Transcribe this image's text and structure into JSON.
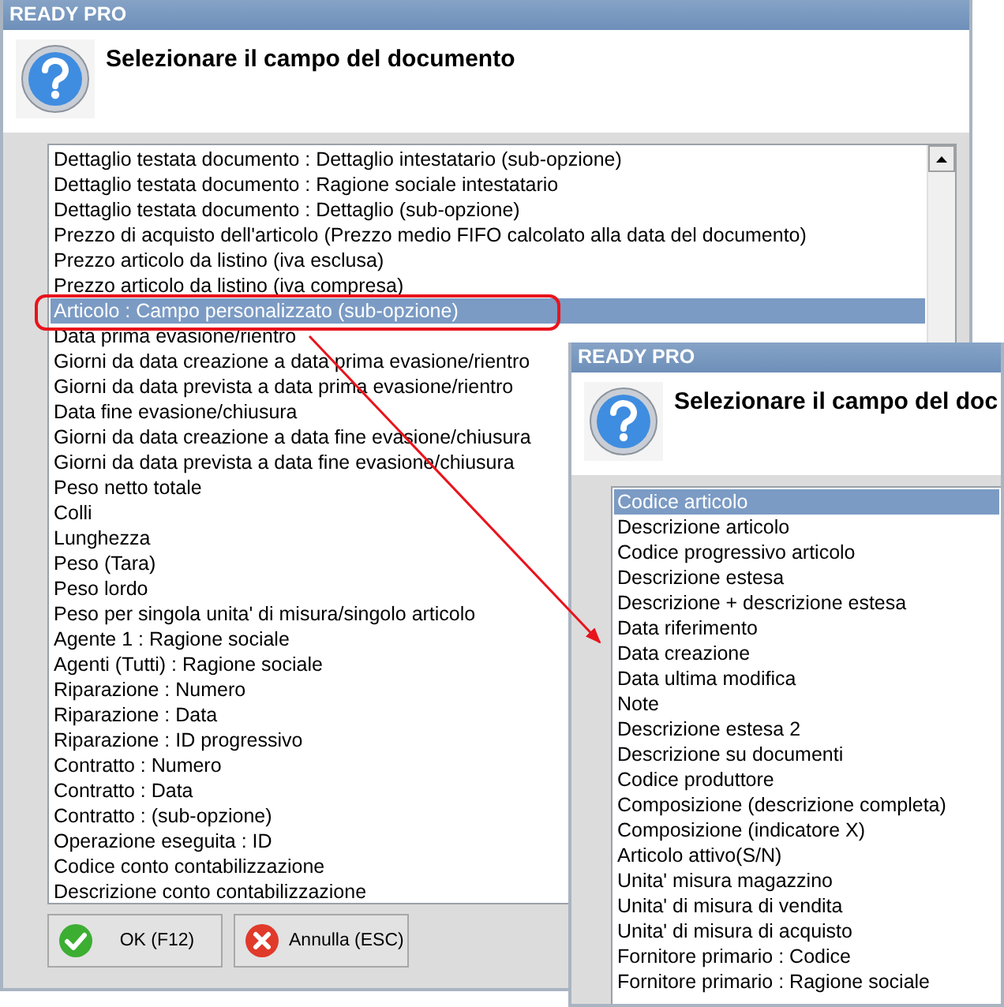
{
  "windows": [
    {
      "title": "READY PRO",
      "heading": "Selezionare il campo del documento",
      "scrollbar": true,
      "items": [
        {
          "label": "Dettaglio testata documento : Dettaglio intestatario (sub-opzione)",
          "selected": false
        },
        {
          "label": "Dettaglio testata documento : Ragione sociale intestatario",
          "selected": false
        },
        {
          "label": "Dettaglio testata documento : Dettaglio (sub-opzione)",
          "selected": false
        },
        {
          "label": "Prezzo di acquisto dell'articolo (Prezzo medio FIFO calcolato alla data del documento)",
          "selected": false
        },
        {
          "label": "Prezzo articolo da listino (iva esclusa)",
          "selected": false
        },
        {
          "label": "Prezzo articolo da listino (iva compresa)",
          "selected": false
        },
        {
          "label": "Articolo : Campo personalizzato (sub-opzione)",
          "selected": true
        },
        {
          "label": "Data prima evasione/rientro",
          "selected": false
        },
        {
          "label": "Giorni da data creazione a data prima evasione/rientro",
          "selected": false
        },
        {
          "label": "Giorni da data prevista a data prima evasione/rientro",
          "selected": false
        },
        {
          "label": "Data fine evasione/chiusura",
          "selected": false
        },
        {
          "label": "Giorni da data creazione a data fine evasione/chiusura",
          "selected": false
        },
        {
          "label": "Giorni da data prevista a data fine evasione/chiusura",
          "selected": false
        },
        {
          "label": "Peso netto totale",
          "selected": false
        },
        {
          "label": "Colli",
          "selected": false
        },
        {
          "label": "Lunghezza",
          "selected": false
        },
        {
          "label": "Peso (Tara)",
          "selected": false
        },
        {
          "label": "Peso lordo",
          "selected": false
        },
        {
          "label": "Peso per singola unita' di misura/singolo articolo",
          "selected": false
        },
        {
          "label": "Agente 1 : Ragione sociale",
          "selected": false
        },
        {
          "label": "Agenti (Tutti) : Ragione sociale",
          "selected": false
        },
        {
          "label": "Riparazione : Numero",
          "selected": false
        },
        {
          "label": "Riparazione : Data",
          "selected": false
        },
        {
          "label": "Riparazione : ID progressivo",
          "selected": false
        },
        {
          "label": "Contratto : Numero",
          "selected": false
        },
        {
          "label": "Contratto : Data",
          "selected": false
        },
        {
          "label": "Contratto : (sub-opzione)",
          "selected": false
        },
        {
          "label": "Operazione eseguita : ID",
          "selected": false
        },
        {
          "label": "Codice conto contabilizzazione",
          "selected": false
        },
        {
          "label": "Descrizione conto contabilizzazione",
          "selected": false
        }
      ],
      "buttons": [
        {
          "label": "OK (F12)",
          "kind": "ok"
        },
        {
          "label": "Annulla (ESC)",
          "kind": "cancel"
        }
      ]
    },
    {
      "title": "READY PRO",
      "heading": "Selezionare il campo del doc",
      "scrollbar": false,
      "items": [
        {
          "label": "Codice articolo",
          "selected": true
        },
        {
          "label": "Descrizione articolo",
          "selected": false
        },
        {
          "label": "Codice progressivo articolo",
          "selected": false
        },
        {
          "label": "Descrizione estesa",
          "selected": false
        },
        {
          "label": "Descrizione + descrizione estesa",
          "selected": false
        },
        {
          "label": "Data riferimento",
          "selected": false
        },
        {
          "label": "Data creazione",
          "selected": false
        },
        {
          "label": "Data ultima modifica",
          "selected": false
        },
        {
          "label": "Note",
          "selected": false
        },
        {
          "label": "Descrizione estesa 2",
          "selected": false
        },
        {
          "label": "Descrizione su documenti",
          "selected": false
        },
        {
          "label": "Codice produttore",
          "selected": false
        },
        {
          "label": "Composizione (descrizione completa)",
          "selected": false
        },
        {
          "label": "Composizione (indicatore X)",
          "selected": false
        },
        {
          "label": "Articolo attivo(S/N)",
          "selected": false
        },
        {
          "label": "Unita' misura magazzino",
          "selected": false
        },
        {
          "label": "Unita' di misura di vendita",
          "selected": false
        },
        {
          "label": "Unita' di misura di acquisto",
          "selected": false
        },
        {
          "label": "Fornitore primario : Codice",
          "selected": false
        },
        {
          "label": "Fornitore primario : Ragione sociale",
          "selected": false
        }
      ]
    }
  ]
}
